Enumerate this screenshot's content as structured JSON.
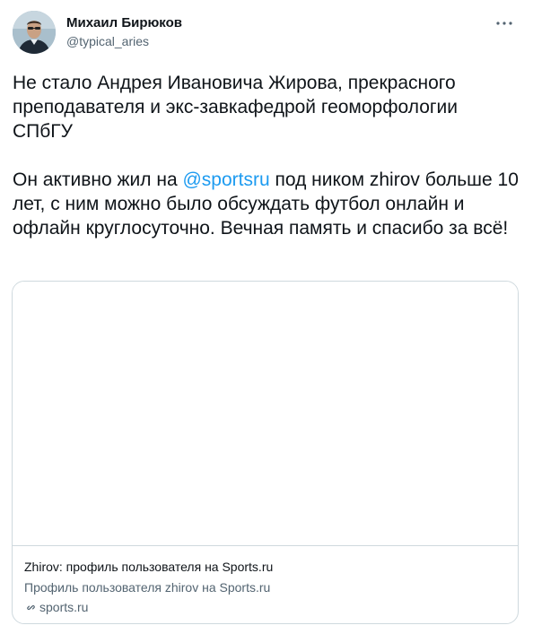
{
  "author": {
    "name": "Михаил Бирюков",
    "handle": "@typical_aries"
  },
  "icons": {
    "more": "more-horizontal-icon",
    "link": "link-icon"
  },
  "tweet": {
    "paragraph1": "Не стало Андрея Ивановича Жирова, прекрасного преподавателя и экс-завкафедрой геоморфологии СПбГУ",
    "paragraph2_before": "Он активно жил на ",
    "mention": "@sportsru",
    "paragraph2_after": " под ником zhirov больше 10 лет, с ним можно было обсуждать футбол онлайн и офлайн круглосуточно. Вечная память и спасибо за всё!"
  },
  "card": {
    "title": "Zhirov: профиль пользователя на Sports.ru",
    "description": "Профиль пользователя zhirov на Sports.ru",
    "domain": "sports.ru"
  },
  "colors": {
    "accent": "#1d9bf0",
    "text": "#0f1419",
    "secondary": "#536471",
    "border": "#cfd9de"
  }
}
